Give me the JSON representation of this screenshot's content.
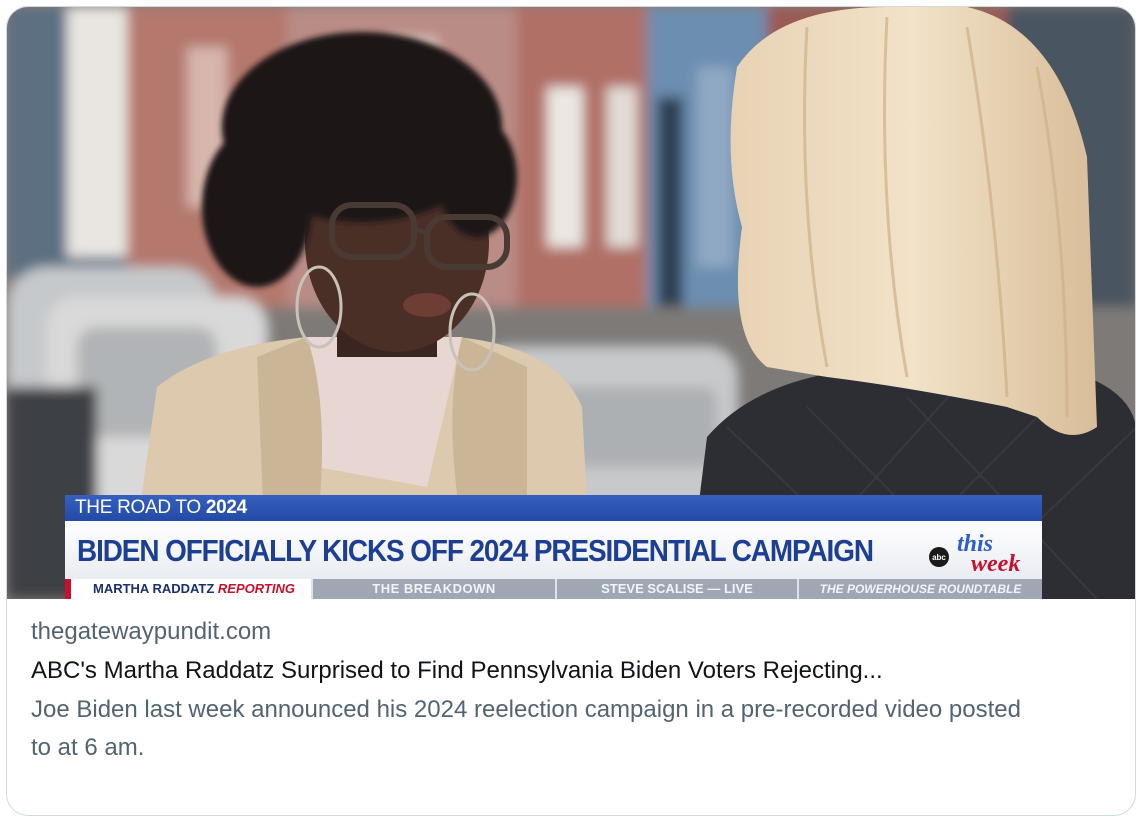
{
  "link_card": {
    "domain": "thegatewaypundit.com",
    "title": "ABC's Martha Raddatz Surprised to Find Pennsylvania Biden Voters Rejecting...",
    "description": "Joe Biden last week announced his 2024 reelection campaign in a pre-recorded video posted to at 6 am."
  },
  "chyron": {
    "road_prefix": "THE ROAD TO ",
    "road_year": "2024",
    "headline": "BIDEN OFFICIALLY KICKS OFF 2024 PRESIDENTIAL CAMPAIGN",
    "logo_abc": "abc",
    "logo_this": "this",
    "logo_week": "week",
    "ticker": {
      "reporter_name": "MARTHA RADDATZ ",
      "reporter_role": "REPORTING",
      "breakdown": "THE BREAKDOWN",
      "scalise": "STEVE SCALISE — LIVE",
      "roundtable": "THE POWERHOUSE ROUNDTABLE"
    }
  },
  "colors": {
    "chyron_blue": "#234aa5",
    "headline_navy": "#1d3f93",
    "accent_red": "#c8102e",
    "muted_text": "#536471"
  }
}
